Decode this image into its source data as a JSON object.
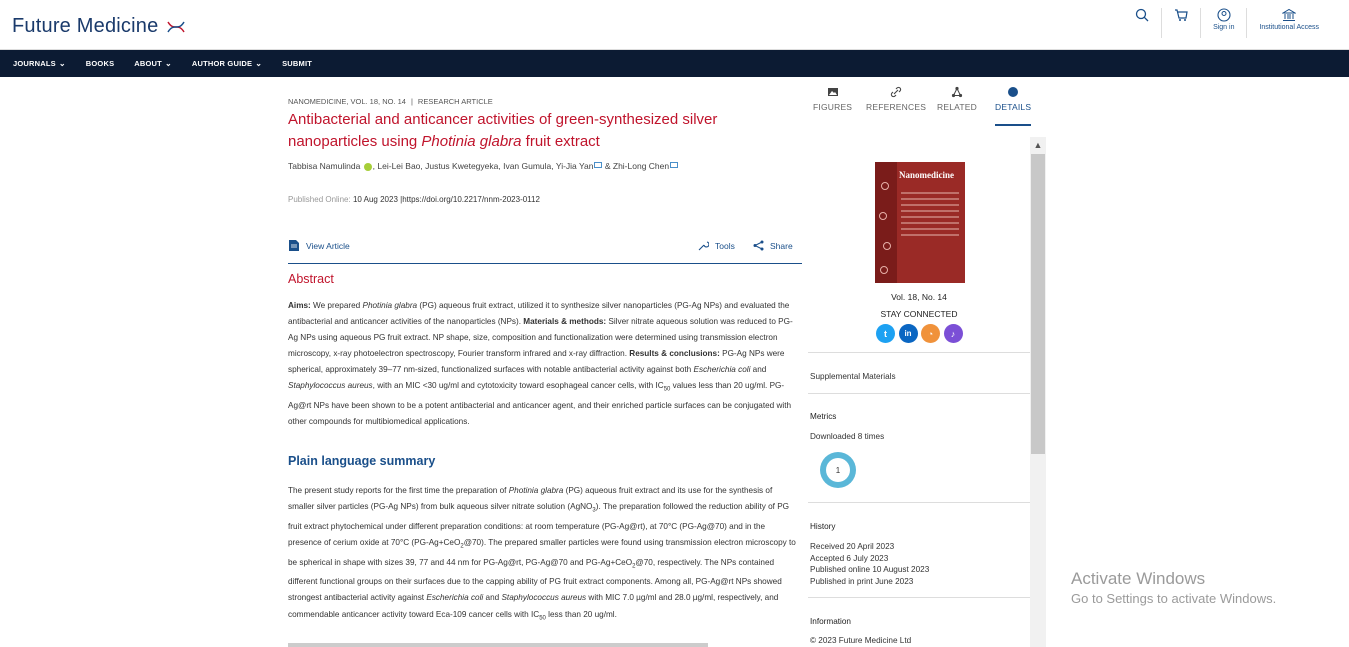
{
  "header": {
    "logo_text": "Future Medicine",
    "icons": [
      {
        "name": "search-icon",
        "label": ""
      },
      {
        "name": "cart-icon",
        "label": ""
      },
      {
        "name": "sign-in-icon",
        "label": "Sign in"
      },
      {
        "name": "institution-icon",
        "label": "Institutional Access"
      }
    ]
  },
  "nav": {
    "items": [
      {
        "label": "JOURNALS",
        "dropdown": true
      },
      {
        "label": "BOOKS",
        "dropdown": false
      },
      {
        "label": "ABOUT",
        "dropdown": true
      },
      {
        "label": "AUTHOR GUIDE",
        "dropdown": true
      },
      {
        "label": "SUBMIT",
        "dropdown": false
      }
    ]
  },
  "article": {
    "journal_line": "NANOMEDICINE, VOL. 18, NO. 14",
    "article_type": "RESEARCH ARTICLE",
    "title_part1": "Antibacterial and anticancer activities of green-synthesized silver nanoparticles using ",
    "title_italic": "Photinia glabra",
    "title_part2": " fruit extract",
    "authors": {
      "a1": "Tabbisa Namulinda",
      "a2": ", Lei-Lei Bao, Justus Kwetegyeka, Ivan Gumula, Yi-Jia Yan",
      "a3": " & Zhi-Long Chen"
    },
    "published_label": "Published Online:",
    "published_date": "10 Aug 2023",
    "doi": "https://doi.org/10.2217/nnm-2023-0112",
    "view_article": "View Article",
    "tools": "Tools",
    "share": "Share",
    "abstract_heading": "Abstract",
    "abstract": {
      "aims_label": "Aims:",
      "aims_1": " We prepared ",
      "aims_it": "Photinia glabra",
      "aims_2": " (PG) aqueous fruit extract, utilized it to synthesize silver nanoparticles (PG-Ag NPs) and evaluated the antibacterial and anticancer activities of the nanoparticles (NPs). ",
      "methods_label": "Materials & methods:",
      "methods": " Silver nitrate aqueous solution was reduced to PG-Ag NPs using aqueous PG fruit extract. NP shape, size, composition and functionalization were determined using transmission electron microscopy, x-ray photoelectron spectroscopy, Fourier transform infrared and x-ray diffraction. ",
      "results_label": "Results & conclusions:",
      "results_1": " PG-Ag NPs were spherical, approximately 39–77 nm-sized, functionalized surfaces with notable antibacterial activity against both ",
      "results_it1": "Escherichia coli",
      "results_2": " and ",
      "results_it2": "Staphylococcus aureus",
      "results_3": ", with an MIC <30 ug/ml and cytotoxicity toward esophageal cancer cells, with IC",
      "results_sub": "50",
      "results_4": " values less than 20 ug/ml. PG-Ag@rt NPs have been shown to be a potent antibacterial and anticancer agent, and their enriched particle surfaces can be conjugated with other compounds for multibiomedical applications."
    },
    "pls_heading": "Plain language summary",
    "pls": {
      "p1": "The present study reports for the first time the preparation of ",
      "p1_it": "Photinia glabra",
      "p2": " (PG) aqueous fruit extract and its use for the synthesis of smaller silver particles (PG-Ag NPs) from bulk aqueous silver nitrate solution (AgNO",
      "p2_sub": "3",
      "p3": "). The preparation followed the reduction ability of PG fruit extract phytochemical under different preparation conditions: at room temperature (PG-Ag@rt), at 70°C (PG-Ag@70) and in the presence of cerium oxide at 70°C (PG-Ag+CeO",
      "p3_sub": "2",
      "p4": "@70). The prepared smaller particles were found using transmission electron microscopy to be spherical in shape with sizes 39, 77 and 44 nm for PG-Ag@rt, PG-Ag@70 and PG-Ag+CeO",
      "p4_sub": "2",
      "p5": "@70, respectively. The NPs contained different functional groups on their surfaces due to the capping ability of PG fruit extract components. Among all, PG-Ag@rt NPs showed strongest antibacterial activity against ",
      "p5_it1": "Escherichia coli",
      "p6": " and ",
      "p6_it": "Staphylococcus aureus",
      "p7": " with MIC 7.0 µg/ml and 28.0 µg/ml, respectively, and commendable anticancer activity toward Eca-109 cancer cells with IC",
      "p7_sub": "50",
      "p8": " less than 20 ug/ml."
    }
  },
  "right_tabs": [
    {
      "label": "FIGURES",
      "icon": "image-icon",
      "active": false
    },
    {
      "label": "REFERENCES",
      "icon": "link-icon",
      "active": false
    },
    {
      "label": "RELATED",
      "icon": "network-icon",
      "active": false
    },
    {
      "label": "DETAILS",
      "icon": "dot-icon",
      "active": true
    }
  ],
  "details": {
    "cover_title": "Nanomedicine",
    "volume": "Vol. 18, No. 14",
    "stay_connected": "STAY CONNECTED",
    "social": [
      {
        "name": "twitter-icon",
        "glyph": "t",
        "color": "#1da1f2"
      },
      {
        "name": "linkedin-icon",
        "glyph": "in",
        "color": "#0a66c2"
      },
      {
        "name": "rss-icon",
        "glyph": "◔",
        "color": "#f0923b"
      },
      {
        "name": "alert-icon",
        "glyph": "♪",
        "color": "#7b4fd6"
      }
    ],
    "supplemental": "Supplemental Materials",
    "metrics_heading": "Metrics",
    "downloaded": "Downloaded 8 times",
    "altmetric_score": "1",
    "history_heading": "History",
    "received": "Received 20 April 2023",
    "accepted": "Accepted 6 July 2023",
    "published_online": "Published online 10 August 2023",
    "published_print": "Published in print June 2023",
    "information_heading": "Information",
    "copyright": "© 2023 Future Medicine Ltd"
  },
  "watermark": {
    "line1": "Activate Windows",
    "line2": "Go to Settings to activate Windows."
  },
  "colors": {
    "navy": "#0c1b33",
    "link_blue": "#1a4f8a",
    "title_red": "#c0142c"
  }
}
